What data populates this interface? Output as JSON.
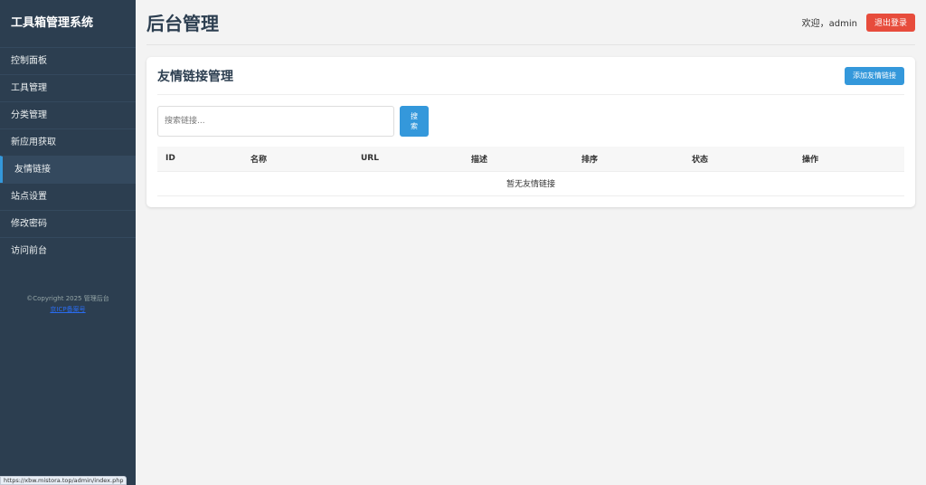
{
  "sidebar": {
    "title": "工具箱管理系统",
    "items": [
      {
        "label": "控制面板"
      },
      {
        "label": "工具管理"
      },
      {
        "label": "分类管理"
      },
      {
        "label": "新应用获取"
      },
      {
        "label": "友情链接"
      },
      {
        "label": "站点设置"
      },
      {
        "label": "修改密码"
      },
      {
        "label": "访问前台"
      }
    ],
    "active_index": 4,
    "copyright": "©Copyright 2025 管理后台",
    "copyright_link": "京ICP备案号"
  },
  "header": {
    "title": "后台管理",
    "welcome": "欢迎，admin",
    "logout_label": "退出登录"
  },
  "card": {
    "title": "友情链接管理",
    "add_label": "添加友情链接",
    "search_placeholder": "搜索链接...",
    "search_label": "搜\n索",
    "columns": [
      "ID",
      "名称",
      "URL",
      "描述",
      "排序",
      "状态",
      "操作"
    ],
    "empty_text": "暂无友情链接"
  },
  "status_bar": {
    "url": "https://xbw.mistora.top/admin/index.php"
  },
  "colors": {
    "sidebar_bg": "#2c3e50",
    "accent": "#3498db",
    "danger": "#e74c3c"
  }
}
